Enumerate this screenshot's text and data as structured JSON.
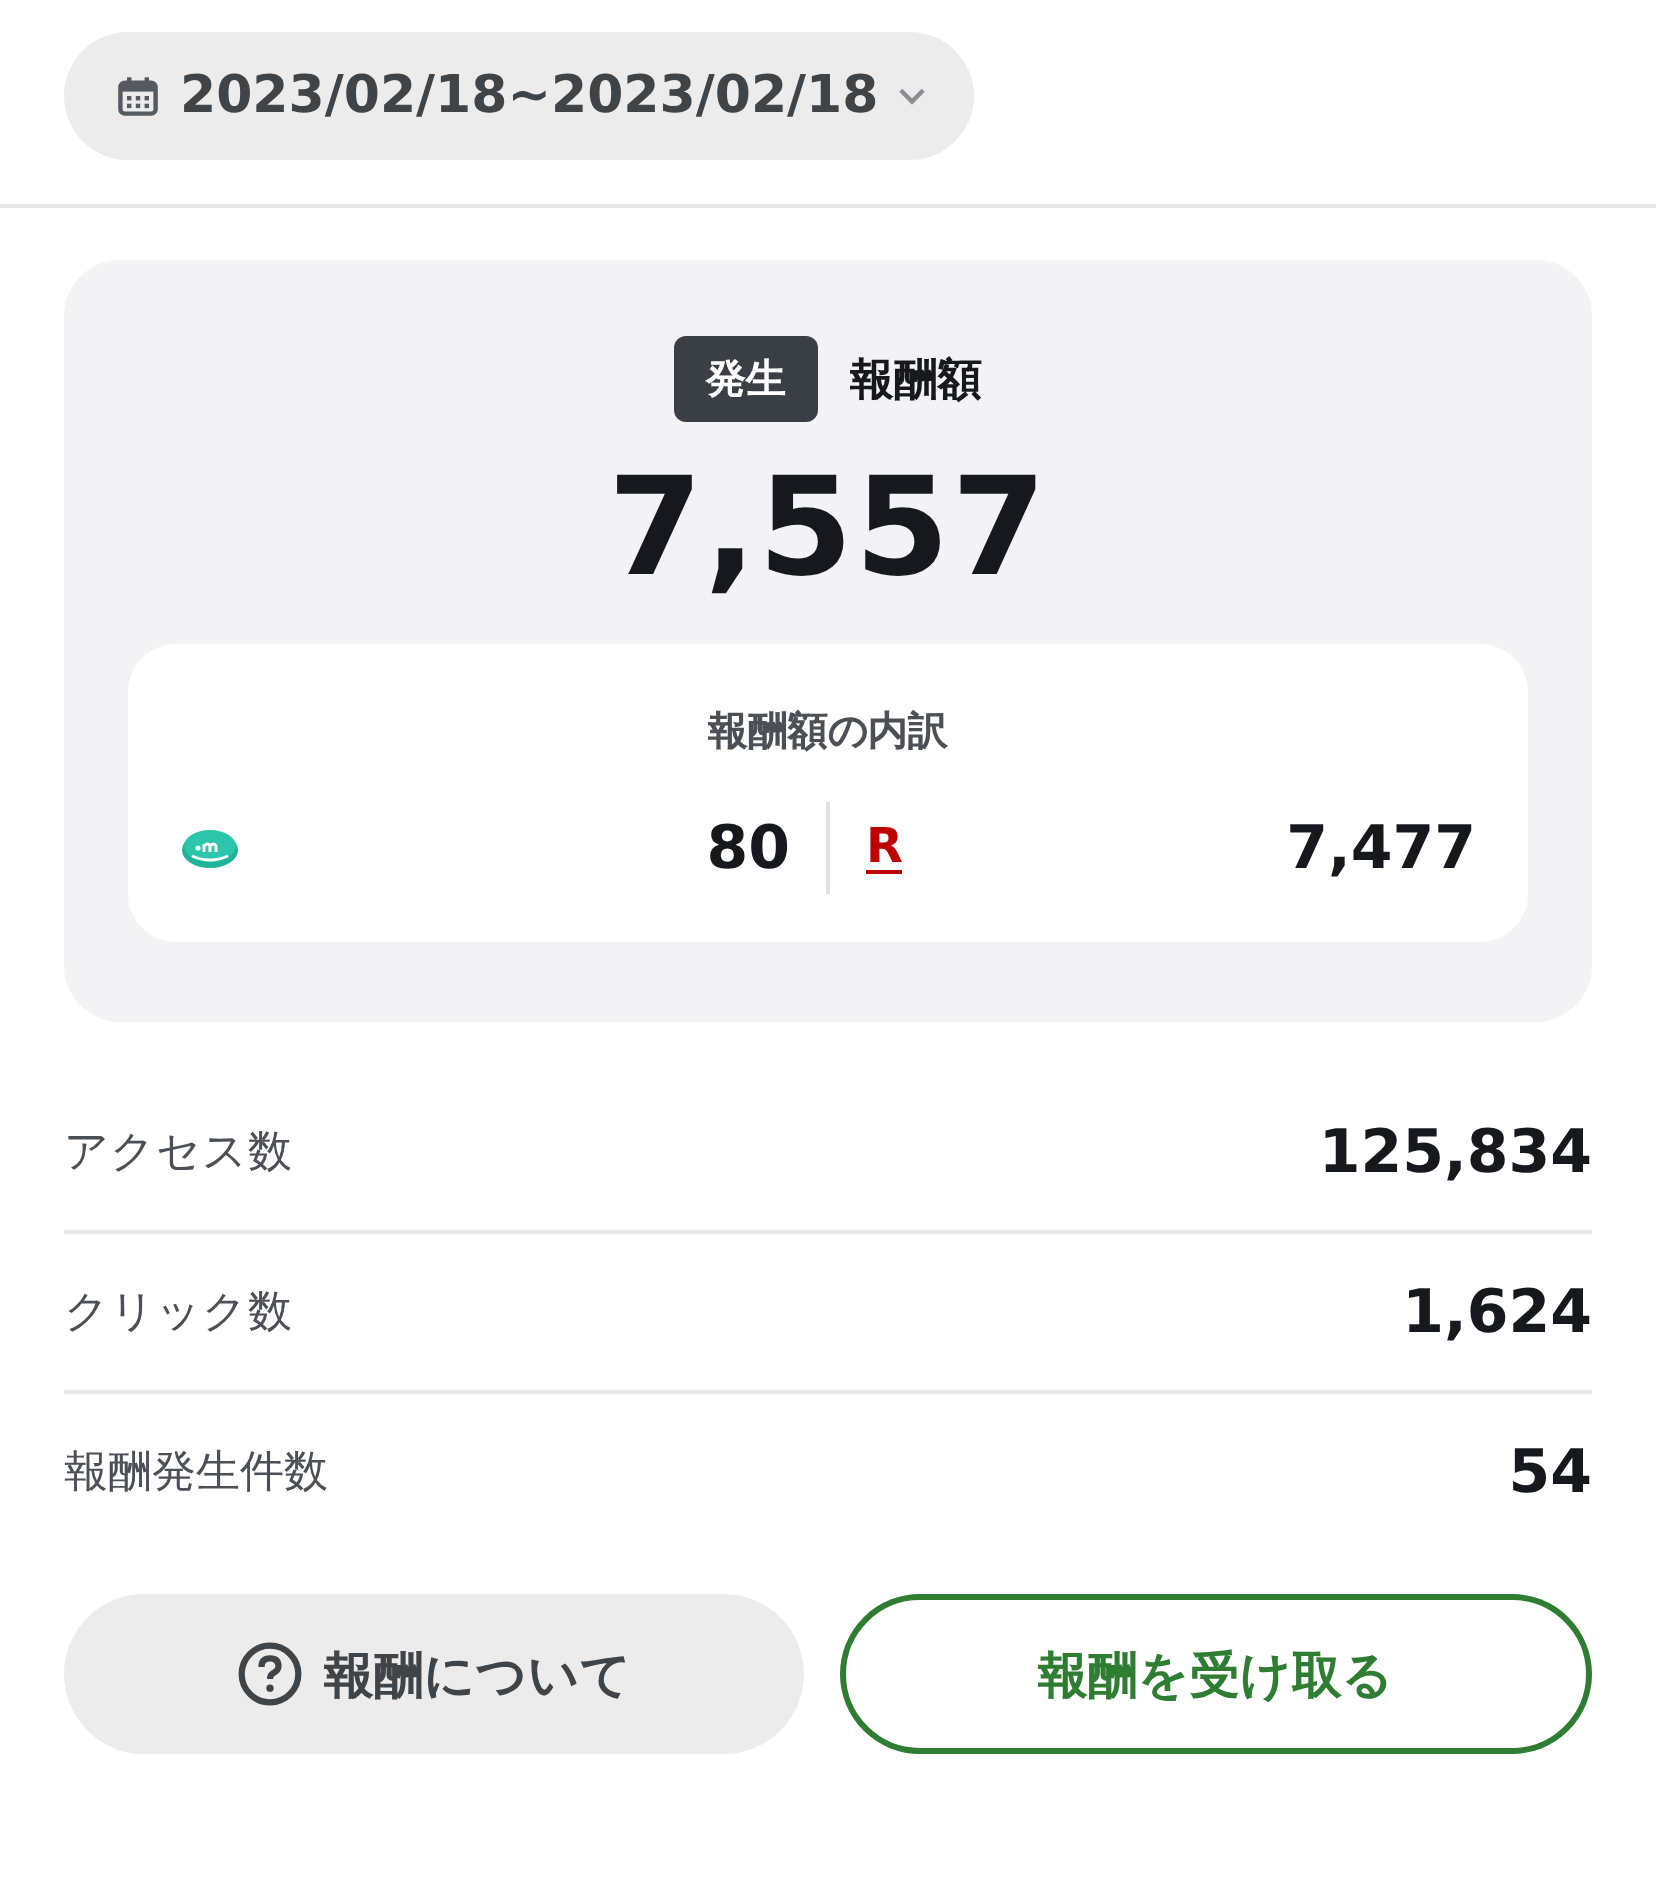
{
  "date_range": {
    "label": "2023/02/18~2023/02/18"
  },
  "summary": {
    "badge": "発生",
    "title": "報酬額",
    "total": "7,557",
    "breakdown": {
      "title": "報酬額の内訳",
      "items": [
        {
          "kind": "coin",
          "value": "80"
        },
        {
          "kind": "letter",
          "symbol": "R",
          "value": "7,477"
        }
      ]
    }
  },
  "stats": [
    {
      "label": "アクセス数",
      "value": "125,834"
    },
    {
      "label": "クリック数",
      "value": "1,624"
    },
    {
      "label": "報酬発生件数",
      "value": "54"
    }
  ],
  "buttons": [
    {
      "kind": "help",
      "label": "報酬について"
    },
    {
      "kind": "primary",
      "label": "報酬を受け取る"
    }
  ]
}
